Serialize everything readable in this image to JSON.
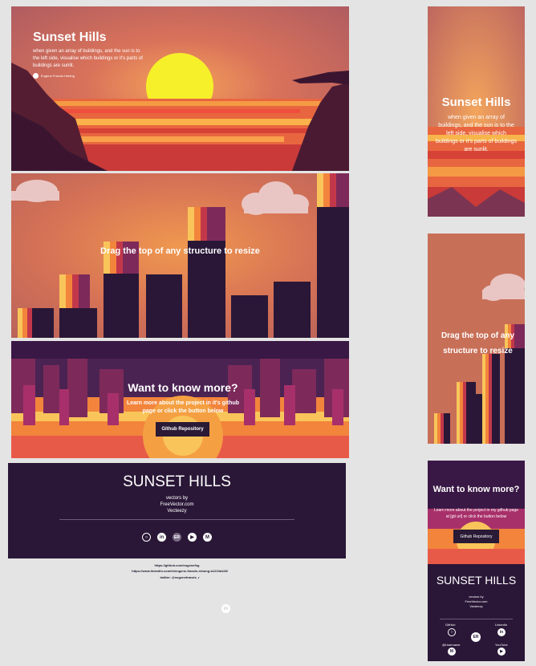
{
  "hero": {
    "title": "Sunset Hills",
    "description": "when given an array of buildings, and the sun is to the left side, visualise which buildings or it's parts of buildings are sunlit.",
    "author": "Eugene Franzis Hebing"
  },
  "drag": {
    "title": "Drag the top of any structure to resize"
  },
  "more": {
    "title": "Want to know more?",
    "text": "Learn more about the project in it's github page  or click the button below",
    "button": "Github Repository"
  },
  "footer": {
    "title": "SUNSET HILLS",
    "line1": "vectors by",
    "line2": "FreeVector.com",
    "line3": "Vecteezy"
  },
  "links": {
    "github": "https://github.com/eugenefvg",
    "linkedin": "https://www.linkedin.com/in/eugene-franzis-rebong-b1219a128/",
    "twitter": "twitter: @eugenefranzis_r"
  },
  "mobile": {
    "hero_title": "Sunset Hills",
    "hero_text": "when given an array of buildings, and the sun is to the left side, visualise which buildings or it's parts of buildings are sunlit.",
    "drag_title": "Drag the top of any structure to resize",
    "more_title": "Want to know more?",
    "more_text": "Learn more about the project in my github page at [git url] or click the button below",
    "button": "Github Repository",
    "footer_title": "SUNSET HILLS",
    "footer_line1": "vectors by",
    "footer_line2": "FreeVector.com",
    "footer_line3": "Vecteezy",
    "github_label": "GitHub",
    "linkedin_label": "LinkedIn",
    "gmail_label": "@Username",
    "youtube_label": "YouTube"
  },
  "colors": {
    "sky_top": "#a65a5f",
    "sky_mid": "#e06a48",
    "sun": "#f6f02a",
    "dark": "#2a1737",
    "accent_yellow": "#f9c55a",
    "accent_orange": "#f2843c",
    "accent_red": "#c2384a",
    "accent_purple": "#7d2a5a"
  }
}
